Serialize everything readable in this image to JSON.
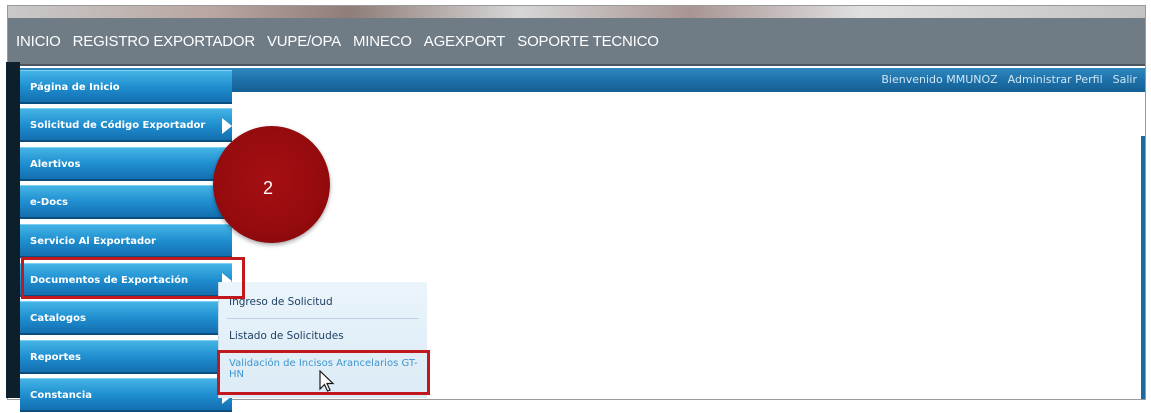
{
  "topnav": {
    "items": [
      "INICIO",
      "REGISTRO EXPORTADOR",
      "VUPE/OPA",
      "MINECO",
      "AGEXPORT",
      "SOPORTE TECNICO"
    ]
  },
  "userbar": {
    "welcome": "Bienvenido MMUNOZ",
    "profile": "Administrar Perfil",
    "logout": "Salir"
  },
  "sidebar": {
    "items": [
      {
        "label": "Página de Inicio"
      },
      {
        "label": "Solicitud de Código Exportador"
      },
      {
        "label": "Alertivos"
      },
      {
        "label": "e-Docs"
      },
      {
        "label": "Servicio Al Exportador"
      },
      {
        "label": "Documentos de Exportación"
      },
      {
        "label": "Catalogos"
      },
      {
        "label": "Reportes"
      },
      {
        "label": "Constancia"
      }
    ]
  },
  "submenu": {
    "items": [
      "Ingreso de Solicitud",
      "Listado de Solicitudes",
      "Validación de Incisos Arancelarios GT-HN"
    ]
  },
  "annotation": {
    "step": "2"
  },
  "colors": {
    "nav_bg": "#6f7c86",
    "sidebar_button": "#1f8fd0",
    "highlight_red": "#c0181c",
    "step_badge": "#950b0e"
  }
}
